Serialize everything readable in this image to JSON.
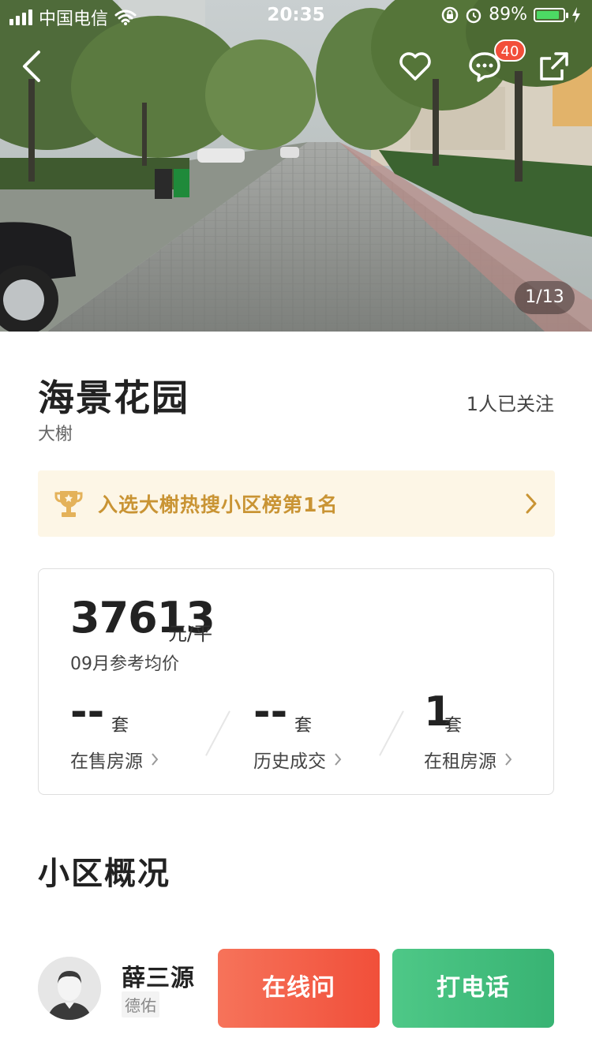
{
  "status_bar": {
    "carrier": "中国电信",
    "time": "20:35",
    "battery_percent": "89%",
    "battery_level": 0.89
  },
  "gallery": {
    "counter": "1/13",
    "message_badge": "40"
  },
  "community": {
    "name": "海景花园",
    "district": "大榭",
    "followers": "1人已关注"
  },
  "ranking": {
    "text": "入选大榭热搜小区榜第1名"
  },
  "price_card": {
    "price": "37613",
    "price_unit": "元/平",
    "price_label": "09月参考均价",
    "stats": [
      {
        "value": "--",
        "unit": "套",
        "label": "在售房源"
      },
      {
        "value": "--",
        "unit": "套",
        "label": "历史成交"
      },
      {
        "value": "1",
        "unit": "套",
        "label": "在租房源"
      }
    ]
  },
  "section": {
    "title": "小区概况"
  },
  "agent": {
    "name": "薛三源",
    "company": "德佑",
    "online_button": "在线问",
    "call_button": "打电话"
  },
  "colors": {
    "accent_orange": "#f14f3a",
    "accent_green": "#38b373",
    "rank_text": "#c99434",
    "rank_bg": "#fdf6e6"
  }
}
